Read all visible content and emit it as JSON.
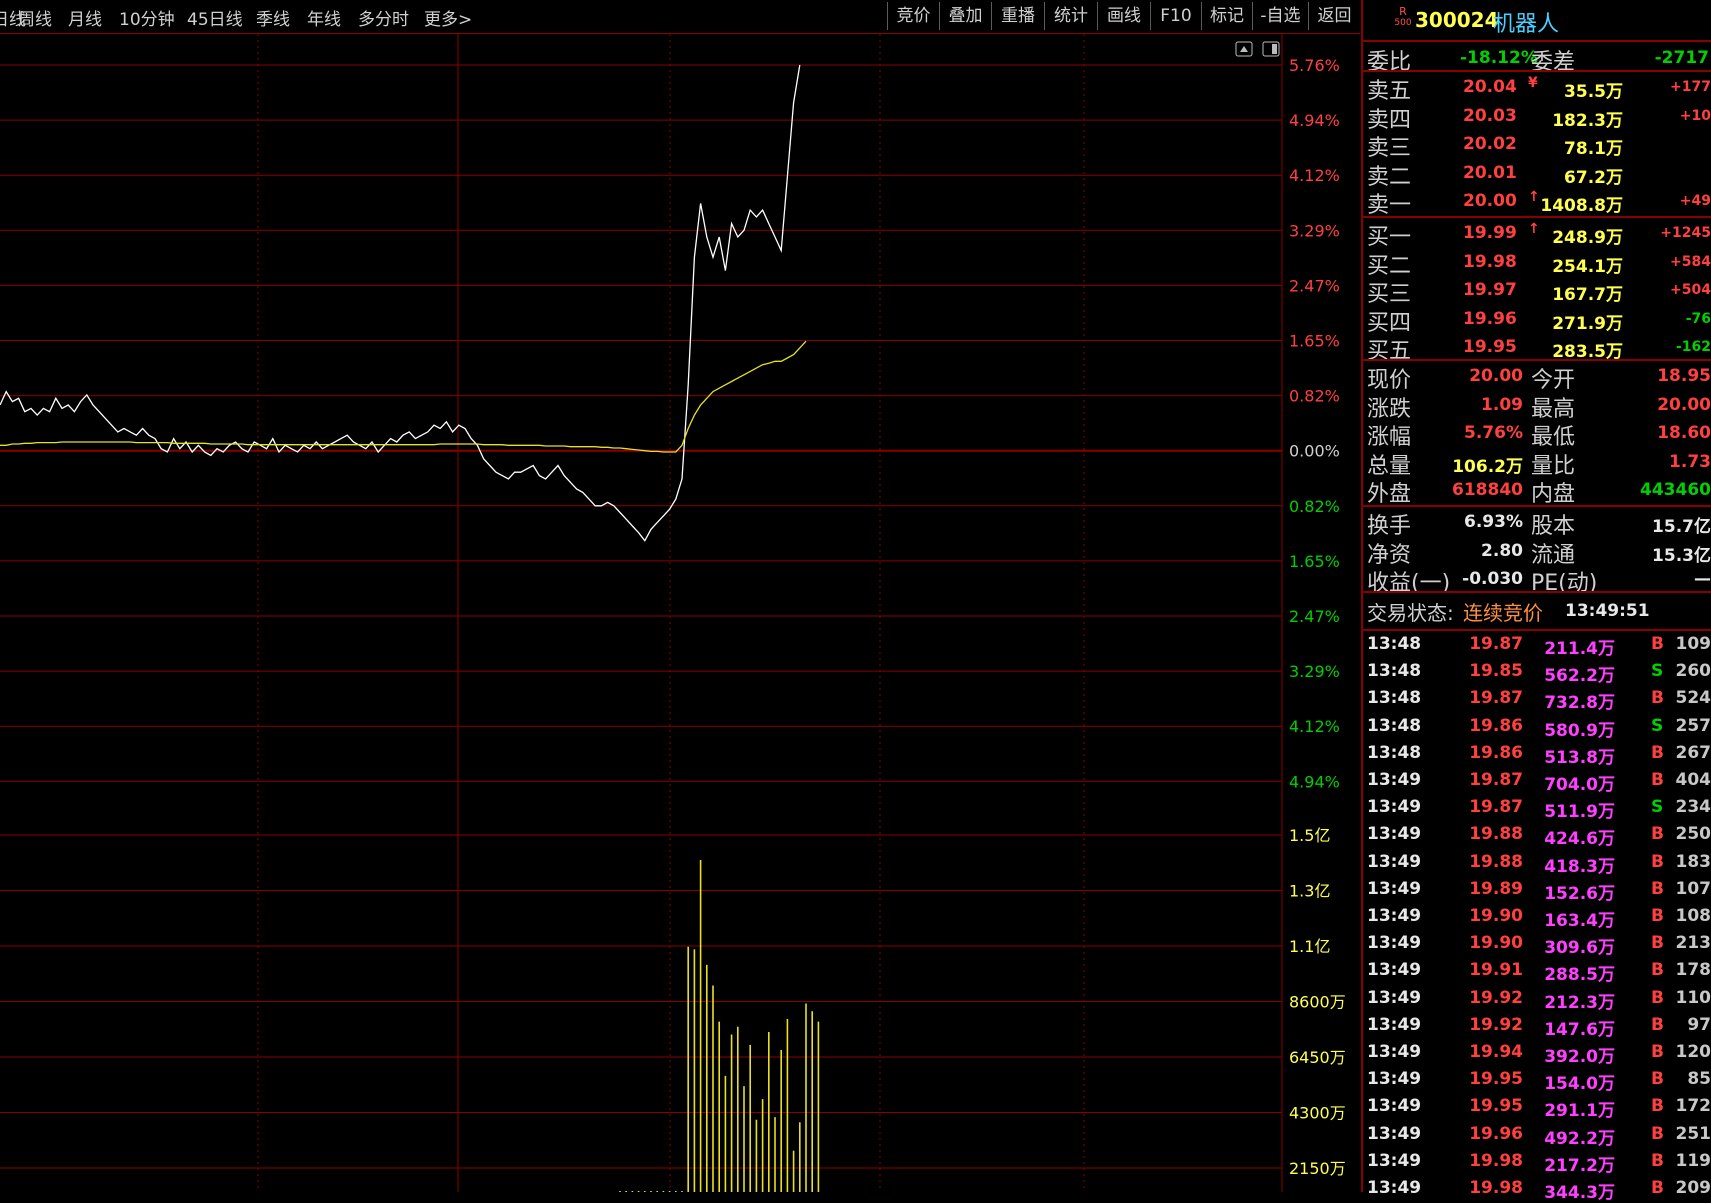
{
  "toolbar": {
    "periods": [
      "日线",
      "周线",
      "月线",
      "10分钟",
      "45日线",
      "季线",
      "年线",
      "多分时",
      "更多>"
    ],
    "tools": [
      "竞价",
      "叠加",
      "重播",
      "统计",
      "画线",
      "F10",
      "标记",
      "-自选",
      "返回"
    ]
  },
  "chart": {
    "price_axis": [
      "5.76%",
      "4.94%",
      "4.12%",
      "3.29%",
      "2.47%",
      "1.65%",
      "0.82%",
      "0.00%",
      "0.82%",
      "1.65%",
      "2.47%",
      "3.29%",
      "4.12%",
      "4.94%"
    ],
    "volume_axis": [
      "1.5亿",
      "1.3亿",
      "1.1亿",
      "8600万",
      "6450万",
      "4300万",
      "2150万"
    ]
  },
  "chart_data": {
    "type": "line",
    "series": [
      {
        "values": [
          0.7,
          0.9,
          0.75,
          0.8,
          0.6,
          0.65,
          0.55,
          0.65,
          0.6,
          0.8,
          0.65,
          0.7,
          0.6,
          0.75,
          0.85,
          0.7,
          0.6,
          0.5,
          0.4,
          0.3,
          0.35,
          0.3,
          0.25,
          0.35,
          0.25,
          0.2,
          0.05,
          0.0,
          0.2,
          0.05,
          0.15,
          0.0,
          0.1,
          0.0,
          -0.05,
          0.05,
          0.0,
          0.1,
          0.15,
          0.05,
          0.0,
          0.15,
          0.1,
          0.05,
          0.2,
          0.0,
          0.1,
          0.05,
          0.0,
          0.1,
          0.05,
          0.15,
          0.05,
          0.1,
          0.15,
          0.2,
          0.25,
          0.15,
          0.1,
          0.05,
          0.15,
          0.0,
          0.1,
          0.2,
          0.15,
          0.25,
          0.3,
          0.2,
          0.25,
          0.3,
          0.4,
          0.35,
          0.45,
          0.3,
          0.4,
          0.35,
          0.2,
          0.1,
          -0.1,
          -0.2,
          -0.3,
          -0.35,
          -0.4,
          -0.3,
          -0.3,
          -0.25,
          -0.2,
          -0.35,
          -0.4,
          -0.3,
          -0.2,
          -0.35,
          -0.45,
          -0.55,
          -0.6,
          -0.7,
          -0.8,
          -0.8,
          -0.75,
          -0.8,
          -0.9,
          -1.0,
          -1.1,
          -1.2,
          -1.32,
          -1.15,
          -1.05,
          -0.95,
          -0.85,
          -0.7,
          -0.4,
          1.0,
          2.9,
          3.7,
          3.2,
          2.9,
          3.2,
          2.7,
          3.4,
          3.2,
          3.3,
          3.6,
          3.5,
          3.6,
          3.4,
          3.2,
          3.0,
          4.1,
          5.2,
          5.76
        ]
      },
      {
        "values": [
          0.1,
          0.1,
          0.12,
          0.12,
          0.13,
          0.13,
          0.14,
          0.14,
          0.14,
          0.14,
          0.15,
          0.15,
          0.15,
          0.15,
          0.15,
          0.15,
          0.15,
          0.15,
          0.15,
          0.15,
          0.15,
          0.15,
          0.14,
          0.14,
          0.14,
          0.14,
          0.14,
          0.14,
          0.13,
          0.13,
          0.13,
          0.13,
          0.13,
          0.13,
          0.12,
          0.12,
          0.12,
          0.12,
          0.12,
          0.12,
          0.11,
          0.11,
          0.11,
          0.11,
          0.11,
          0.11,
          0.11,
          0.11,
          0.11,
          0.11,
          0.11,
          0.11,
          0.11,
          0.11,
          0.11,
          0.11,
          0.11,
          0.11,
          0.11,
          0.11,
          0.11,
          0.11,
          0.11,
          0.11,
          0.11,
          0.11,
          0.11,
          0.11,
          0.11,
          0.11,
          0.11,
          0.12,
          0.12,
          0.12,
          0.12,
          0.12,
          0.12,
          0.12,
          0.11,
          0.11,
          0.11,
          0.11,
          0.1,
          0.1,
          0.1,
          0.1,
          0.1,
          0.1,
          0.09,
          0.09,
          0.09,
          0.09,
          0.08,
          0.08,
          0.08,
          0.08,
          0.08,
          0.07,
          0.07,
          0.06,
          0.06,
          0.05,
          0.04,
          0.03,
          0.02,
          0.01,
          0.01,
          0.0,
          0.0,
          0.0,
          0.1,
          0.35,
          0.55,
          0.7,
          0.8,
          0.9,
          0.95,
          1.0,
          1.05,
          1.1,
          1.15,
          1.2,
          1.25,
          1.3,
          1.32,
          1.35,
          1.35,
          1.4,
          1.45,
          1.55,
          1.65
        ]
      },
      {
        "values": [
          0,
          0,
          0,
          0,
          0,
          0,
          0,
          0,
          0,
          0,
          0,
          0,
          0,
          0,
          0,
          0,
          0,
          0,
          0,
          0,
          0,
          0,
          0,
          0,
          0,
          0,
          0,
          0,
          0,
          0,
          0,
          0,
          0,
          0,
          0,
          0,
          0,
          0,
          0,
          0,
          0,
          0,
          0,
          0,
          0,
          0,
          0,
          0,
          0,
          0,
          0,
          0,
          0,
          0,
          0,
          0,
          0,
          0,
          0,
          0,
          0,
          0,
          0,
          0,
          0,
          0,
          0,
          0,
          0,
          0,
          0,
          0,
          0,
          0,
          0,
          0,
          0,
          0,
          0,
          0,
          0,
          0,
          0,
          0,
          0,
          0,
          0,
          0,
          0,
          0,
          0,
          0,
          0,
          0,
          0,
          0,
          0,
          0,
          0,
          0,
          0.5,
          0.3,
          0.6,
          0.4,
          0.8,
          0.5,
          0.3,
          0.4,
          0.8,
          1.2,
          0.6,
          9500,
          9400,
          14000,
          8800,
          8000,
          6600,
          4500,
          6100,
          6400,
          4100,
          5700,
          2800,
          3600,
          6200,
          2900,
          5500,
          6700,
          1600,
          2700,
          7300,
          7000,
          6600
        ]
      }
    ],
    "ylim_price_pct": [
      -4.94,
      5.76
    ],
    "ylim_volume": [
      0,
      16000
    ]
  },
  "quote": {
    "badge_top": "R",
    "badge_bottom": "500",
    "code": "300024",
    "name": "机器人",
    "weibi_label": "委比",
    "weibi_value": "-18.12%",
    "weicha_label": "委差",
    "weicha_value": "-2717",
    "asks": [
      {
        "label": "卖五",
        "price": "20.04",
        "vol": "35.5万",
        "chg": "+177",
        "arrow": "¥"
      },
      {
        "label": "卖四",
        "price": "20.03",
        "vol": "182.3万",
        "chg": "+10",
        "arrow": ""
      },
      {
        "label": "卖三",
        "price": "20.02",
        "vol": "78.1万",
        "chg": "",
        "arrow": ""
      },
      {
        "label": "卖二",
        "price": "20.01",
        "vol": "67.2万",
        "chg": "",
        "arrow": ""
      },
      {
        "label": "卖一",
        "price": "20.00",
        "vol": "1408.8万",
        "chg": "+49",
        "arrow": "↑"
      }
    ],
    "bids": [
      {
        "label": "买一",
        "price": "19.99",
        "vol": "248.9万",
        "chg": "+1245",
        "arrow": "↑"
      },
      {
        "label": "买二",
        "price": "19.98",
        "vol": "254.1万",
        "chg": "+584",
        "arrow": ""
      },
      {
        "label": "买三",
        "price": "19.97",
        "vol": "167.7万",
        "chg": "+504",
        "arrow": ""
      },
      {
        "label": "买四",
        "price": "19.96",
        "vol": "271.9万",
        "chg": "-76",
        "arrow": ""
      },
      {
        "label": "买五",
        "price": "19.95",
        "vol": "283.5万",
        "chg": "-162",
        "arrow": ""
      }
    ],
    "stats_a": [
      {
        "l1": "现价",
        "v1": "20.00",
        "l2": "今开",
        "v2": "18.95"
      },
      {
        "l1": "涨跌",
        "v1": "1.09",
        "l2": "最高",
        "v2": "20.00"
      },
      {
        "l1": "涨幅",
        "v1": "5.76%",
        "l2": "最低",
        "v2": "18.60"
      },
      {
        "l1": "总量",
        "v1": "106.2万",
        "l2": "量比",
        "v2": "1.73"
      },
      {
        "l1": "外盘",
        "v1": "618840",
        "l2": "内盘",
        "v2": "443460"
      }
    ],
    "stats_b": [
      {
        "l1": "换手",
        "v1": "6.93%",
        "l2": "股本",
        "v2": "15.7亿"
      },
      {
        "l1": "净资",
        "v1": "2.80",
        "l2": "流通",
        "v2": "15.3亿"
      },
      {
        "l1": "收益(一)",
        "v1": "-0.030",
        "l2": "PE(动)",
        "v2": "—"
      }
    ],
    "trade_status_label": "交易状态:",
    "trade_status_value": "连续竞价",
    "trade_status_time": "13:49:51",
    "ticks": [
      {
        "t": "13:48",
        "p": "19.87",
        "a": "211.4万",
        "s": "B",
        "v": "109"
      },
      {
        "t": "13:48",
        "p": "19.85",
        "a": "562.2万",
        "s": "S",
        "v": "260"
      },
      {
        "t": "13:48",
        "p": "19.87",
        "a": "732.8万",
        "s": "B",
        "v": "524"
      },
      {
        "t": "13:48",
        "p": "19.86",
        "a": "580.9万",
        "s": "S",
        "v": "257"
      },
      {
        "t": "13:48",
        "p": "19.86",
        "a": "513.8万",
        "s": "B",
        "v": "267"
      },
      {
        "t": "13:49",
        "p": "19.87",
        "a": "704.0万",
        "s": "B",
        "v": "404"
      },
      {
        "t": "13:49",
        "p": "19.87",
        "a": "511.9万",
        "s": "S",
        "v": "234"
      },
      {
        "t": "13:49",
        "p": "19.88",
        "a": "424.6万",
        "s": "B",
        "v": "250"
      },
      {
        "t": "13:49",
        "p": "19.88",
        "a": "418.3万",
        "s": "B",
        "v": "183"
      },
      {
        "t": "13:49",
        "p": "19.89",
        "a": "152.6万",
        "s": "B",
        "v": "107"
      },
      {
        "t": "13:49",
        "p": "19.90",
        "a": "163.4万",
        "s": "B",
        "v": "108"
      },
      {
        "t": "13:49",
        "p": "19.90",
        "a": "309.6万",
        "s": "B",
        "v": "213"
      },
      {
        "t": "13:49",
        "p": "19.91",
        "a": "288.5万",
        "s": "B",
        "v": "178"
      },
      {
        "t": "13:49",
        "p": "19.92",
        "a": "212.3万",
        "s": "B",
        "v": "110"
      },
      {
        "t": "13:49",
        "p": "19.92",
        "a": "147.6万",
        "s": "B",
        "v": "97"
      },
      {
        "t": "13:49",
        "p": "19.94",
        "a": "392.0万",
        "s": "B",
        "v": "120"
      },
      {
        "t": "13:49",
        "p": "19.95",
        "a": "154.0万",
        "s": "B",
        "v": "85"
      },
      {
        "t": "13:49",
        "p": "19.95",
        "a": "291.1万",
        "s": "B",
        "v": "172"
      },
      {
        "t": "13:49",
        "p": "19.96",
        "a": "492.2万",
        "s": "B",
        "v": "251"
      },
      {
        "t": "13:49",
        "p": "19.98",
        "a": "217.2万",
        "s": "B",
        "v": "119"
      },
      {
        "t": "13:49",
        "p": "19.98",
        "a": "344.3万",
        "s": "B",
        "v": "209"
      }
    ],
    "colors": {
      "up": "#ff4040",
      "down": "#00d000",
      "border": "#8a0000",
      "grid": "#8a0000"
    }
  }
}
